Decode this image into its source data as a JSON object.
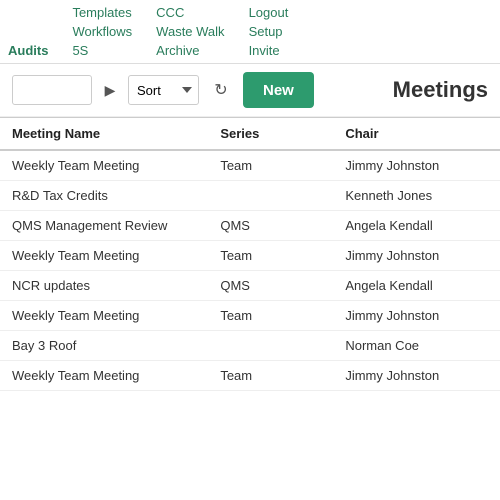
{
  "nav": {
    "columns": [
      {
        "id": "col1",
        "items": [
          "",
          "",
          "Audits"
        ]
      },
      {
        "id": "col2",
        "items": [
          "Templates",
          "Workflows",
          "5S"
        ]
      },
      {
        "id": "col3",
        "items": [
          "CCC",
          "Waste Walk",
          "Archive"
        ]
      },
      {
        "id": "col4",
        "items": [
          "Logout",
          "Setup",
          "Invite"
        ]
      }
    ]
  },
  "toolbar": {
    "search_placeholder": "",
    "sort_label": "Sort",
    "new_label": "New",
    "refresh_title": "Refresh"
  },
  "page": {
    "title": "Meetings"
  },
  "table": {
    "columns": [
      {
        "key": "name",
        "label": "Meeting Name"
      },
      {
        "key": "series",
        "label": "Series"
      },
      {
        "key": "chair",
        "label": "Chair"
      }
    ],
    "rows": [
      {
        "name": "Weekly Team Meeting",
        "series": "Team",
        "chair": "Jimmy Johnston"
      },
      {
        "name": "R&D Tax Credits",
        "series": "",
        "chair": "Kenneth Jones"
      },
      {
        "name": "QMS Management Review",
        "series": "QMS",
        "chair": "Angela Kendall"
      },
      {
        "name": "Weekly Team Meeting",
        "series": "Team",
        "chair": "Jimmy Johnston"
      },
      {
        "name": "NCR updates",
        "series": "QMS",
        "chair": "Angela Kendall"
      },
      {
        "name": "Weekly Team Meeting",
        "series": "Team",
        "chair": "Jimmy Johnston"
      },
      {
        "name": "Bay 3 Roof",
        "series": "",
        "chair": "Norman Coe"
      },
      {
        "name": "Weekly Team Meeting",
        "series": "Team",
        "chair": "Jimmy Johnston"
      }
    ]
  }
}
